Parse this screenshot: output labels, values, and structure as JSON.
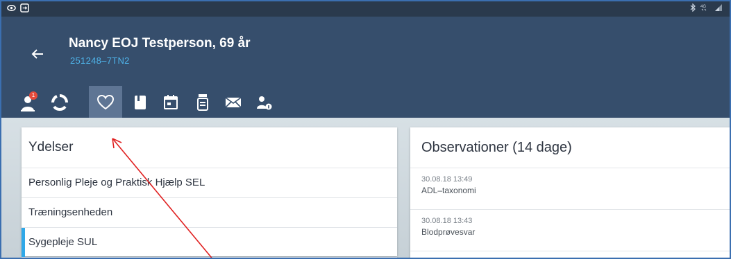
{
  "patient": {
    "name_line": "Nancy EOJ Testperson, 69 år",
    "cpr": "251248–7TN2"
  },
  "toolbar": {
    "badge_count": "1",
    "active": "heart-icon",
    "icons": [
      "person-alert-icon",
      "circle-progress-icon",
      "heart-icon",
      "book-icon",
      "calendar-icon",
      "medicine-icon",
      "mail-icon",
      "person-info-icon"
    ]
  },
  "ydelser": {
    "title": "Ydelser",
    "items": [
      {
        "label": "Personlig Pleje og Praktisk Hjælp SEL"
      },
      {
        "label": "Træningsenheden"
      },
      {
        "label": "Sygepleje SUL"
      }
    ],
    "selected_index": 2
  },
  "observationer": {
    "title": "Observationer (14 dage)",
    "items": [
      {
        "date": "30.08.18 13:49",
        "label": "ADL–taxonomi"
      },
      {
        "date": "30.08.18 13:43",
        "label": "Blodprøvesvar"
      }
    ]
  },
  "colors": {
    "header": "#364e6c",
    "accent": "#2fa8e8",
    "subtitle": "#4fb4ea",
    "annotation_arrow": "#e02020"
  }
}
